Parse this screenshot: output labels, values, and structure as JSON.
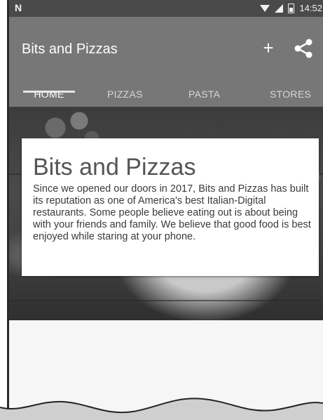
{
  "status_bar": {
    "left_icon": "notification-n-icon",
    "icons": [
      "wifi-icon",
      "signal-icon",
      "battery-icon"
    ],
    "time": "14:52"
  },
  "app_bar": {
    "title": "Bits and Pizzas",
    "add_label": "+",
    "share_icon": "share-icon"
  },
  "tabs": [
    {
      "label": "HOME",
      "active": true
    },
    {
      "label": "PIZZAS",
      "active": false
    },
    {
      "label": "PASTA",
      "active": false
    },
    {
      "label": "STORES",
      "active": false
    }
  ],
  "card": {
    "title": "Bits and Pizzas",
    "body": "Since we opened our doors in 2017, Bits and Pizzas has built its reputation as one of America's best Italian-Digital restaurants. Some people believe eating out is about being with your friends and family. We believe that good food is best enjoyed while staring at your phone."
  },
  "colors": {
    "status_bar": "#4a4a4a",
    "app_bar": "#777777",
    "card": "#ffffff"
  }
}
